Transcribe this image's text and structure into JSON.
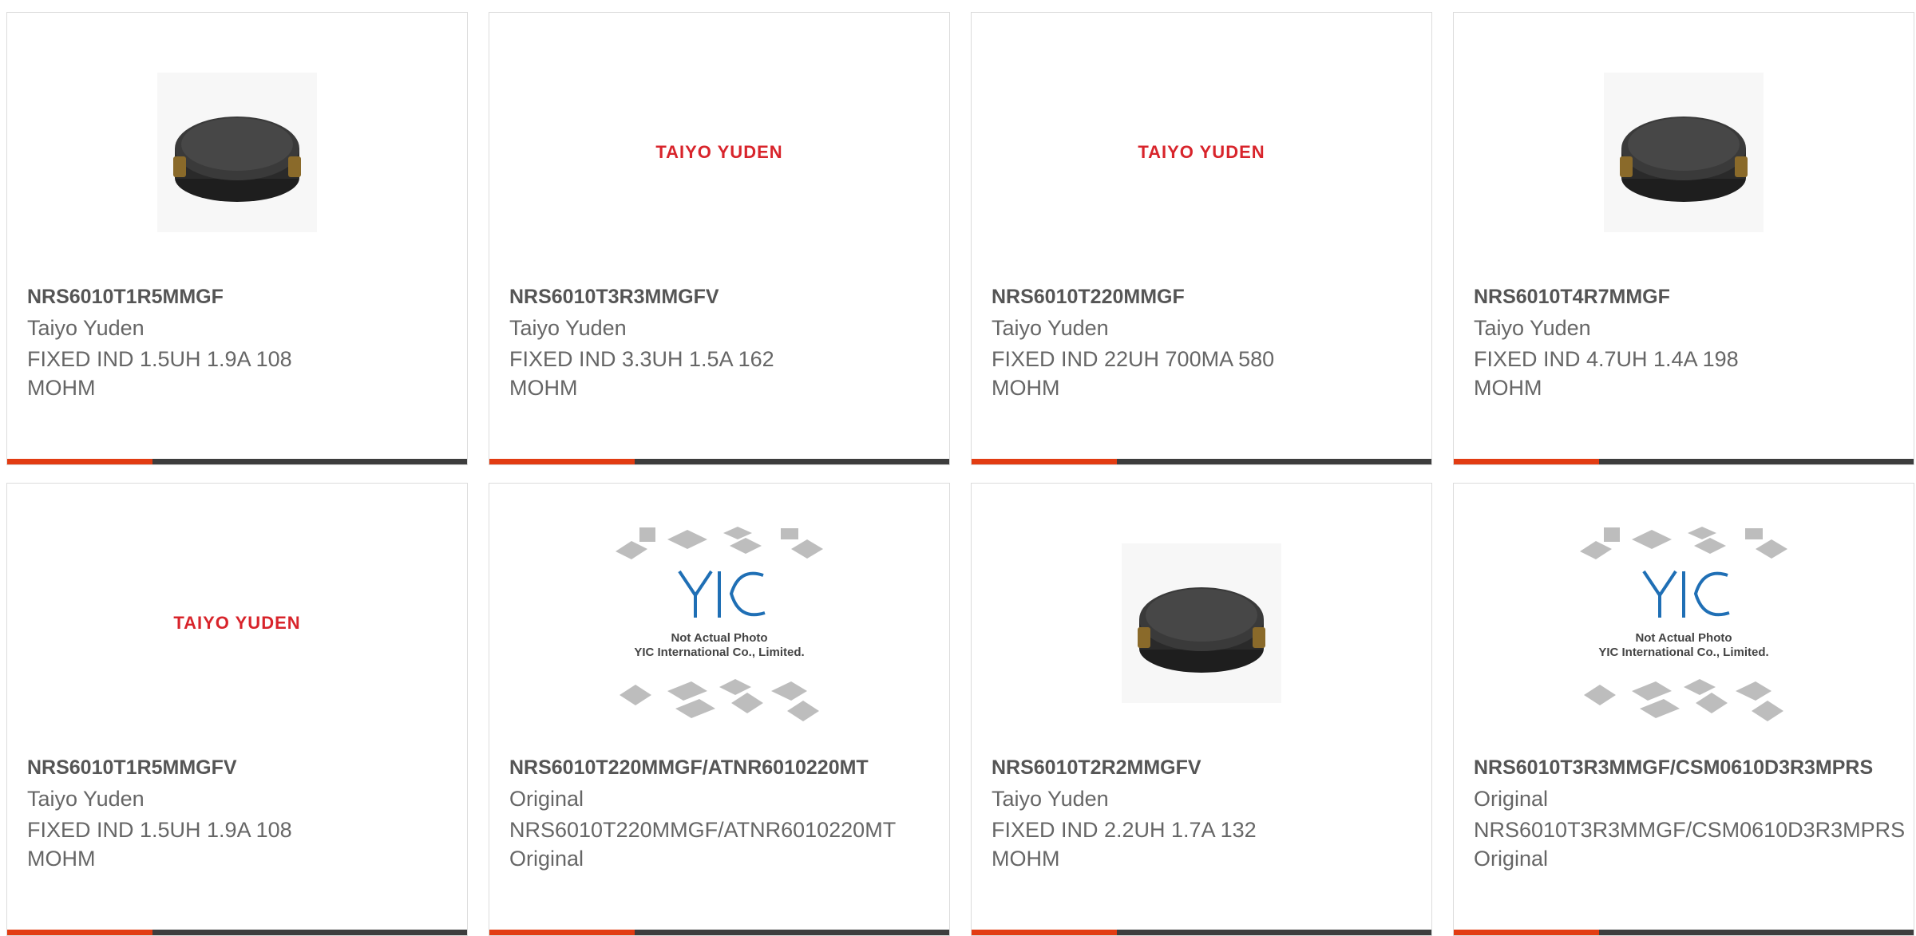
{
  "products": [
    {
      "part": "NRS6010T1R5MMGF",
      "maker": "Taiyo Yuden",
      "desc": "FIXED IND 1.5UH 1.9A 108 MOHM",
      "image": "inductor-photo"
    },
    {
      "part": "NRS6010T3R3MMGFV",
      "maker": "Taiyo Yuden",
      "desc": "FIXED IND 3.3UH 1.5A 162 MOHM",
      "image": "taiyo-yuden-logo",
      "logo_text": "TAIYO YUDEN"
    },
    {
      "part": "NRS6010T220MMGF",
      "maker": "Taiyo Yuden",
      "desc": "FIXED IND 22UH 700MA 580 MOHM",
      "image": "taiyo-yuden-logo",
      "logo_text": "TAIYO YUDEN"
    },
    {
      "part": "NRS6010T4R7MMGF",
      "maker": "Taiyo Yuden",
      "desc": "FIXED IND 4.7UH 1.4A 198 MOHM",
      "image": "inductor-photo"
    },
    {
      "part": "NRS6010T1R5MMGFV",
      "maker": "Taiyo Yuden",
      "desc": "FIXED IND 1.5UH 1.9A 108 MOHM",
      "image": "taiyo-yuden-logo",
      "logo_text": "TAIYO YUDEN"
    },
    {
      "part": "NRS6010T220MMGF/ATNR6010220MT",
      "maker": "Original",
      "desc": "NRS6010T220MMGF/ATNR6010220MT Original",
      "image": "yic-placeholder",
      "placeholder_line1": "Not Actual Photo",
      "placeholder_line2": "YIC International Co., Limited."
    },
    {
      "part": "NRS6010T2R2MMGFV",
      "maker": "Taiyo Yuden",
      "desc": "FIXED IND 2.2UH 1.7A 132 MOHM",
      "image": "inductor-photo"
    },
    {
      "part": "NRS6010T3R3MMGF/CSM0610D3R3MPRS",
      "maker": "Original",
      "desc": "NRS6010T3R3MMGF/CSM0610D3R3MPRS Original",
      "image": "yic-placeholder",
      "placeholder_line1": "Not Actual Photo",
      "placeholder_line2": "YIC International Co., Limited."
    }
  ],
  "colors": {
    "accent": "#e23c12",
    "bar": "#3d3d3d",
    "logo": "#d8242b",
    "yic_blue": "#1f6fb5"
  }
}
